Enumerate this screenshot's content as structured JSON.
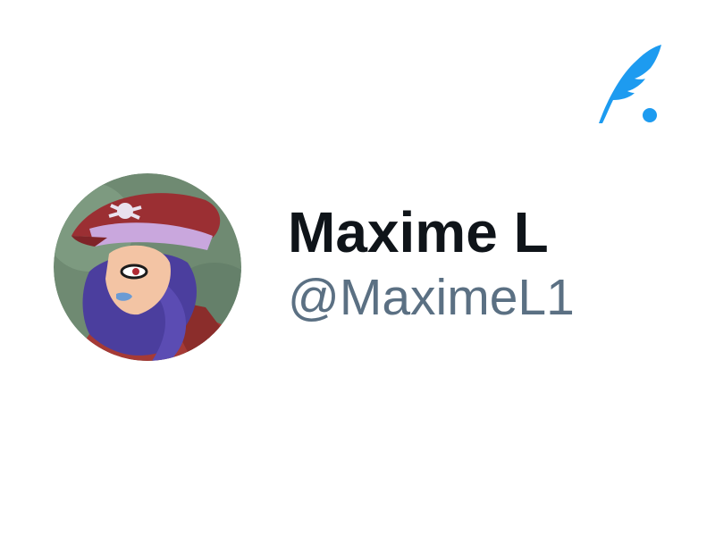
{
  "brand": {
    "icon": "quill-feather-icon",
    "color": "#1d9bf0"
  },
  "profile": {
    "display_name": "Maxime L",
    "handle": "@MaximeL1",
    "avatar": "illustrated-pirate-character-avatar"
  },
  "colors": {
    "name": "#0f1419",
    "handle": "#5b7083",
    "background": "#ffffff"
  }
}
